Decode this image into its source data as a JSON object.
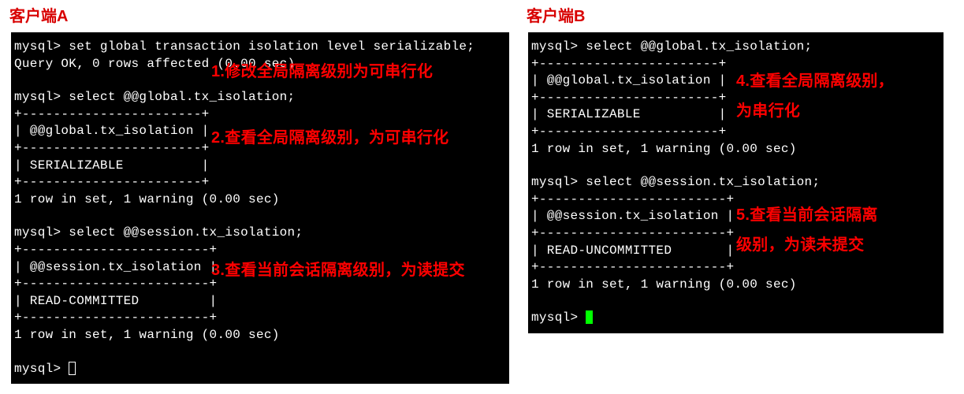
{
  "clientA": {
    "title": "客户端A",
    "lines": {
      "l0": "mysql> set global transaction isolation level serializable;",
      "l1": "Query OK, 0 rows affected (0.00 sec)",
      "l2": "",
      "l3": "mysql> select @@global.tx_isolation;",
      "l4": "+-----------------------+",
      "l5": "| @@global.tx_isolation |",
      "l6": "+-----------------------+",
      "l7": "| SERIALIZABLE          |",
      "l8": "+-----------------------+",
      "l9": "1 row in set, 1 warning (0.00 sec)",
      "l10": "",
      "l11": "mysql> select @@session.tx_isolation;",
      "l12": "+------------------------+",
      "l13": "| @@session.tx_isolation |",
      "l14": "+------------------------+",
      "l15": "| READ-COMMITTED         |",
      "l16": "+------------------------+",
      "l17": "1 row in set, 1 warning (0.00 sec)",
      "l18": "",
      "l19": "mysql> "
    },
    "annotations": {
      "a1": "1.修改全局隔离级别为可串行化",
      "a2": "2.查看全局隔离级别，为可串行化",
      "a3": "3.查看当前会话隔离级别，为读提交"
    }
  },
  "clientB": {
    "title": "客户端B",
    "lines": {
      "l0": "mysql> select @@global.tx_isolation;",
      "l1": "+-----------------------+",
      "l2": "| @@global.tx_isolation |",
      "l3": "+-----------------------+",
      "l4": "| SERIALIZABLE          |",
      "l5": "+-----------------------+",
      "l6": "1 row in set, 1 warning (0.00 sec)",
      "l7": "",
      "l8": "mysql> select @@session.tx_isolation;",
      "l9": "+------------------------+",
      "l10": "| @@session.tx_isolation |",
      "l11": "+------------------------+",
      "l12": "| READ-UNCOMMITTED       |",
      "l13": "+------------------------+",
      "l14": "1 row in set, 1 warning (0.00 sec)",
      "l15": "",
      "l16": "mysql> "
    },
    "annotations": {
      "a4l1": "4.查看全局隔离级别，",
      "a4l2": "为串行化",
      "a5l1": "5.查看当前会话隔离",
      "a5l2": "级别，为读未提交"
    }
  }
}
